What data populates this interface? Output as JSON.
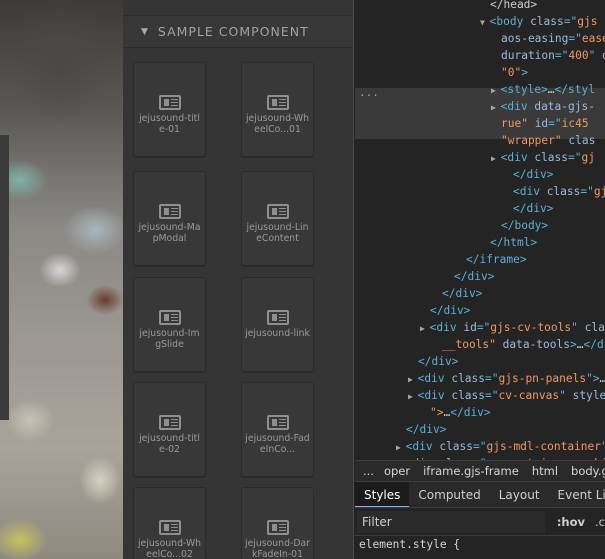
{
  "blocks_panel": {
    "category_title": "SAMPLE COMPONENT",
    "items": [
      {
        "label": "jejusound-title-01"
      },
      {
        "label": "jejusound-WheelCo...01"
      },
      {
        "label": "jejusound-MapModal"
      },
      {
        "label": "jejusound-LineContent"
      },
      {
        "label": "jejusound-ImgSlide"
      },
      {
        "label": "jejusound-link"
      },
      {
        "label": "jejusound-title-02"
      },
      {
        "label": "jejusound-FadeInCo..."
      },
      {
        "label": "jejusound-WheelCo...02"
      },
      {
        "label": "jejusound-DarkFadeIn-01"
      }
    ]
  },
  "devtools": {
    "elements": {
      "lines": [
        {
          "indent": 135,
          "tri": "",
          "tag": "",
          "parts": [
            [
              "tx",
              "</head>"
            ]
          ],
          "cut": true
        },
        {
          "indent": 135,
          "tri": "▼",
          "parts": [
            [
              "tg",
              "<body "
            ],
            [
              "at",
              "class"
            ],
            [
              "tg",
              "=\""
            ],
            [
              "vl",
              "gjs"
            ]
          ]
        },
        {
          "indent": 146,
          "tri": "",
          "parts": [
            [
              "at",
              "aos-easing"
            ],
            [
              "tg",
              "=\""
            ],
            [
              "vl",
              "ease"
            ]
          ]
        },
        {
          "indent": 146,
          "tri": "",
          "parts": [
            [
              "at",
              "duration"
            ],
            [
              "tg",
              "=\""
            ],
            [
              "vl",
              "400"
            ],
            [
              "tg",
              "\" "
            ],
            [
              "at",
              "d"
            ]
          ]
        },
        {
          "indent": 146,
          "tri": "",
          "parts": [
            [
              "vl",
              "\"0\""
            ],
            [
              "tg",
              ">"
            ]
          ]
        },
        {
          "indent": 146,
          "tri": "▶",
          "parts": [
            [
              "tg",
              "<style>"
            ],
            [
              "tx",
              "…"
            ],
            [
              "tg",
              "</styl"
            ]
          ]
        },
        {
          "indent": 146,
          "tri": "▶",
          "parts": [
            [
              "tg",
              "<div "
            ],
            [
              "at",
              "data-gjs-"
            ]
          ]
        },
        {
          "indent": 146,
          "tri": "",
          "parts": [
            [
              "vl",
              "rue\" "
            ],
            [
              "at",
              "id"
            ],
            [
              "tg",
              "=\""
            ],
            [
              "vl",
              "ic45"
            ]
          ]
        },
        {
          "indent": 146,
          "tri": "",
          "parts": [
            [
              "vl",
              "\"wrapper\" "
            ],
            [
              "at",
              "clas"
            ]
          ]
        },
        {
          "indent": 146,
          "tri": "▶",
          "parts": [
            [
              "tg",
              "<div "
            ],
            [
              "at",
              "class"
            ],
            [
              "tg",
              "=\""
            ],
            [
              "vl",
              "gj"
            ]
          ]
        },
        {
          "indent": 158,
          "tri": "",
          "parts": [
            [
              "tg",
              "</div>"
            ]
          ]
        },
        {
          "indent": 158,
          "tri": "",
          "parts": [
            [
              "tg",
              "<div "
            ],
            [
              "at",
              "class"
            ],
            [
              "tg",
              "=\""
            ],
            [
              "vl",
              "gj"
            ]
          ]
        },
        {
          "indent": 158,
          "tri": "",
          "parts": [
            [
              "tg",
              "</div>"
            ]
          ]
        },
        {
          "indent": 146,
          "tri": "",
          "parts": [
            [
              "tg",
              "</body>"
            ]
          ]
        },
        {
          "indent": 135,
          "tri": "",
          "parts": [
            [
              "tg",
              "</html>"
            ]
          ]
        },
        {
          "indent": 111,
          "tri": "",
          "parts": [
            [
              "tg",
              "</iframe>"
            ]
          ]
        },
        {
          "indent": 99,
          "tri": "",
          "parts": [
            [
              "tg",
              "</div>"
            ]
          ]
        },
        {
          "indent": 87,
          "tri": "",
          "parts": [
            [
              "tg",
              "</div>"
            ]
          ]
        },
        {
          "indent": 75,
          "tri": "",
          "parts": [
            [
              "tg",
              "</div>"
            ]
          ]
        },
        {
          "indent": 75,
          "tri": "▶",
          "parts": [
            [
              "tg",
              "<div "
            ],
            [
              "at",
              "id"
            ],
            [
              "tg",
              "=\""
            ],
            [
              "vl",
              "gjs-cv-tools"
            ],
            [
              "tg",
              "\" "
            ],
            [
              "at",
              "clas"
            ]
          ]
        },
        {
          "indent": 87,
          "tri": "",
          "parts": [
            [
              "vl",
              "__tools\" "
            ],
            [
              "at",
              "data-tools"
            ],
            [
              "tg",
              ">"
            ],
            [
              "tx",
              "…"
            ],
            [
              "tg",
              "</div>"
            ]
          ]
        },
        {
          "indent": 63,
          "tri": "",
          "parts": [
            [
              "tg",
              "</div>"
            ]
          ]
        },
        {
          "indent": 63,
          "tri": "▶",
          "parts": [
            [
              "tg",
              "<div "
            ],
            [
              "at",
              "class"
            ],
            [
              "tg",
              "=\""
            ],
            [
              "vl",
              "gjs-pn-panels"
            ],
            [
              "tg",
              "\">"
            ],
            [
              "tx",
              "…"
            ]
          ]
        },
        {
          "indent": 63,
          "tri": "▶",
          "parts": [
            [
              "tg",
              "<div "
            ],
            [
              "at",
              "class"
            ],
            [
              "tg",
              "=\""
            ],
            [
              "vl",
              "cv-canvas"
            ],
            [
              "tg",
              "\" "
            ],
            [
              "at",
              "style"
            ],
            [
              "tg",
              "="
            ]
          ]
        },
        {
          "indent": 75,
          "tri": "",
          "parts": [
            [
              "vl",
              "\">"
            ],
            [
              "tx",
              "…"
            ],
            [
              "tg",
              "</div>"
            ]
          ]
        },
        {
          "indent": 51,
          "tri": "",
          "parts": [
            [
              "tg",
              "</div>"
            ]
          ]
        },
        {
          "indent": 51,
          "tri": "▶",
          "parts": [
            [
              "tg",
              "<div "
            ],
            [
              "at",
              "class"
            ],
            [
              "tg",
              "=\""
            ],
            [
              "vl",
              "gjs-mdl-container"
            ],
            [
              "tg",
              "\""
            ]
          ]
        },
        {
          "indent": 51,
          "tri": "▶",
          "parts": [
            [
              "tg",
              "<div "
            ],
            [
              "at",
              "class"
            ],
            [
              "tg",
              "=\""
            ],
            [
              "vl",
              "sp-container sp-hi"
            ]
          ]
        }
      ]
    },
    "breadcrumbs": {
      "more": "...",
      "items": [
        "oper",
        "iframe.gjs-frame",
        "html",
        "body.gjs-d"
      ]
    },
    "tabs": [
      {
        "label": "Styles",
        "active": true
      },
      {
        "label": "Computed",
        "active": false
      },
      {
        "label": "Layout",
        "active": false
      },
      {
        "label": "Event Listeners",
        "active": false
      }
    ],
    "filter": {
      "placeholder": "Filter",
      "hov": ":hov",
      "cls": ".c"
    },
    "styles": {
      "first_rule": "element.style {"
    }
  }
}
